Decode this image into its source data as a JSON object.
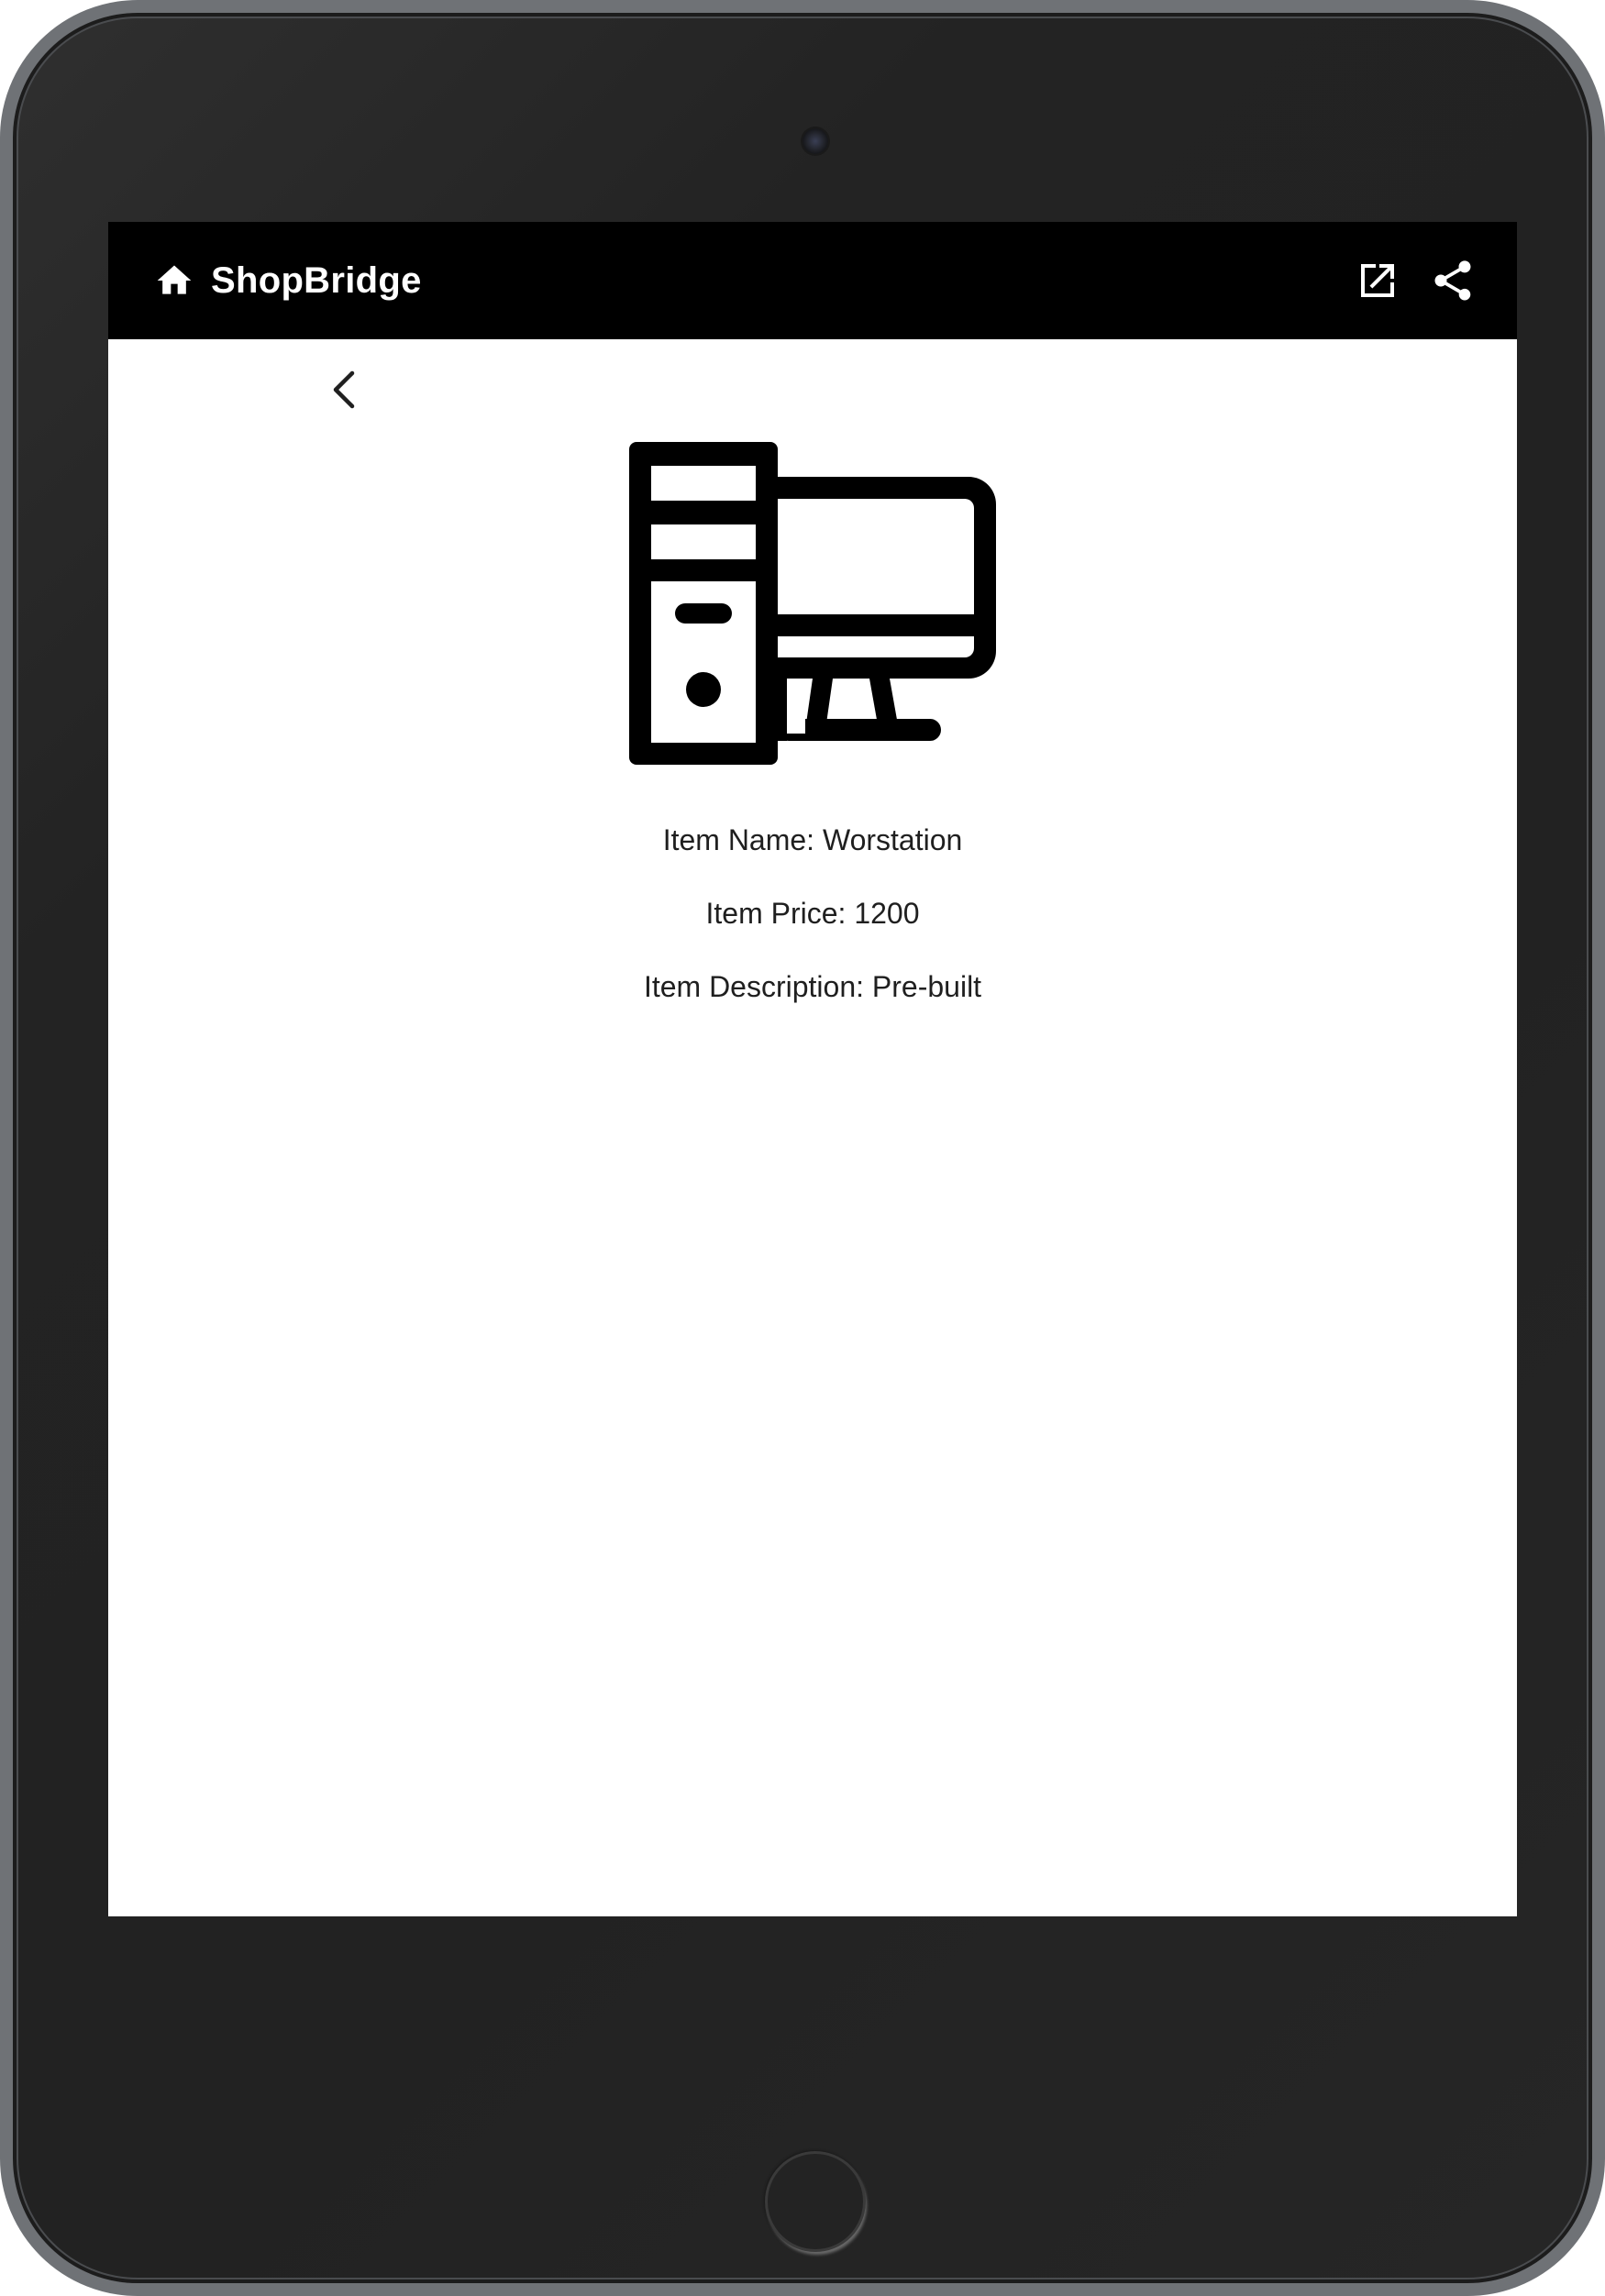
{
  "app": {
    "title": "ShopBridge",
    "icons": {
      "home": "home-icon",
      "open_in_new": "open-in-new-icon",
      "share": "share-icon",
      "back": "chevron-left-icon",
      "product": "desktop-computer-icon"
    }
  },
  "item": {
    "name_line": "Item Name: Worstation",
    "price_line": "Item Price: 1200",
    "description_line": "Item Description: Pre-built"
  },
  "colors": {
    "app_bar_background": "#000000",
    "app_bar_foreground": "#ffffff",
    "screen_background": "#ffffff",
    "text": "#1f1f1f",
    "device_frame": "#232323"
  }
}
